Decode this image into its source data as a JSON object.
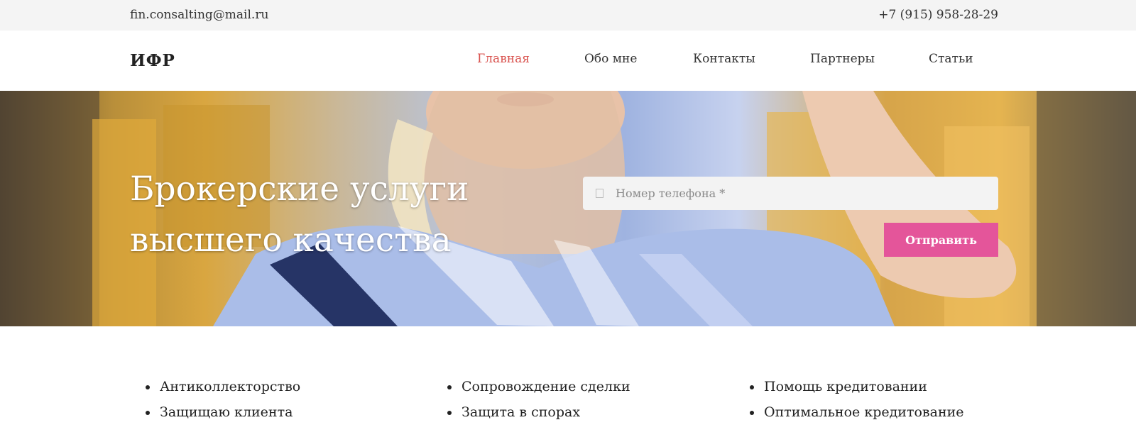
{
  "topbar": {
    "email": "fin.consalting@mail.ru",
    "phone": "+7 (915) 958-28-29"
  },
  "header": {
    "logo": "ИФР",
    "nav": [
      {
        "label": "Главная",
        "active": true
      },
      {
        "label": "Обо мне",
        "active": false
      },
      {
        "label": "Контакты",
        "active": false
      },
      {
        "label": "Партнеры",
        "active": false
      },
      {
        "label": "Статьи",
        "active": false
      }
    ]
  },
  "hero": {
    "title_line1": "Брокерские услуги",
    "title_line2": "высшего качества",
    "phone_placeholder": "Номер телефона *",
    "phone_value": "",
    "submit_label": "Отправить"
  },
  "services": {
    "columns": [
      [
        "Антиколлекторство",
        "Защищаю клиента"
      ],
      [
        "Сопровождение сделки",
        "Защита в спорах"
      ],
      [
        "Помощь кредитовании",
        "Оптимальное кредитование"
      ]
    ]
  },
  "colors": {
    "accent_nav": "#d9534f",
    "button": "#e4559a",
    "topbar_bg": "#f4f4f4"
  },
  "icons": {
    "phone_field_icon": "phone-square-icon"
  }
}
